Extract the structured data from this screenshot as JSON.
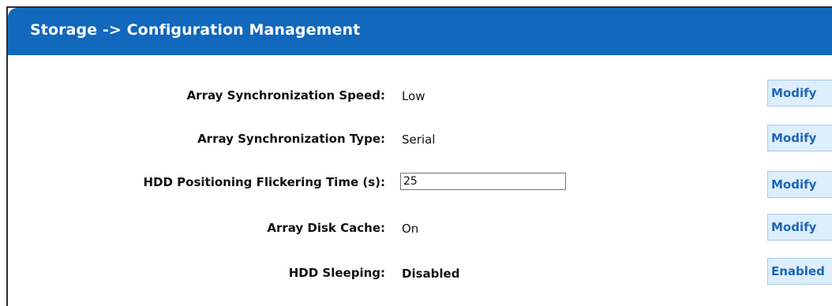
{
  "header": {
    "title": "Storage -> Configuration Management",
    "color": "#1168bd"
  },
  "rows": [
    {
      "label": "Array Synchronization Speed:",
      "value": "Low",
      "button": "Modify"
    },
    {
      "label": "Array Synchronization Type:",
      "value": "Serial",
      "button": "Modify"
    },
    {
      "label": "HDD Positioning Flickering Time (s):",
      "input_value": "25",
      "button": "Modify"
    },
    {
      "label": "Array Disk Cache:",
      "value": "On",
      "button": "Modify"
    },
    {
      "label": "HDD Sleeping:",
      "value": "Disabled",
      "button": "Enabled"
    }
  ],
  "colors": {
    "button_background": "#ddeefc",
    "button_text": "#1e66b6"
  }
}
